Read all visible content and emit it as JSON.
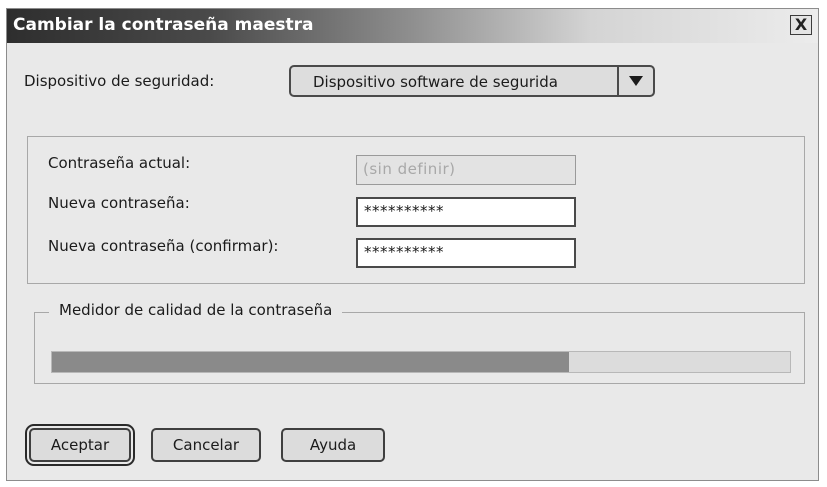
{
  "window": {
    "title": "Cambiar la contraseña maestra",
    "close_label": "X"
  },
  "device": {
    "label": "Dispositivo de seguridad:",
    "selected": "Dispositivo software de segurida",
    "arrow_icon": "triangle-down-icon"
  },
  "passwords": {
    "current_label": "Contraseña actual:",
    "current_value": "(sin definir)",
    "new_label": "Nueva contraseña:",
    "new_value": "**********",
    "confirm_label": "Nueva contraseña (confirmar):",
    "confirm_value": "**********"
  },
  "quality": {
    "legend": "Medidor de calidad de la contraseña",
    "level": 0.7
  },
  "buttons": {
    "accept": "Aceptar",
    "cancel": "Cancelar",
    "help": "Ayuda"
  },
  "colors": {
    "meter_fill": "#8a8a8a",
    "meter_track": "#dcdcdc"
  }
}
